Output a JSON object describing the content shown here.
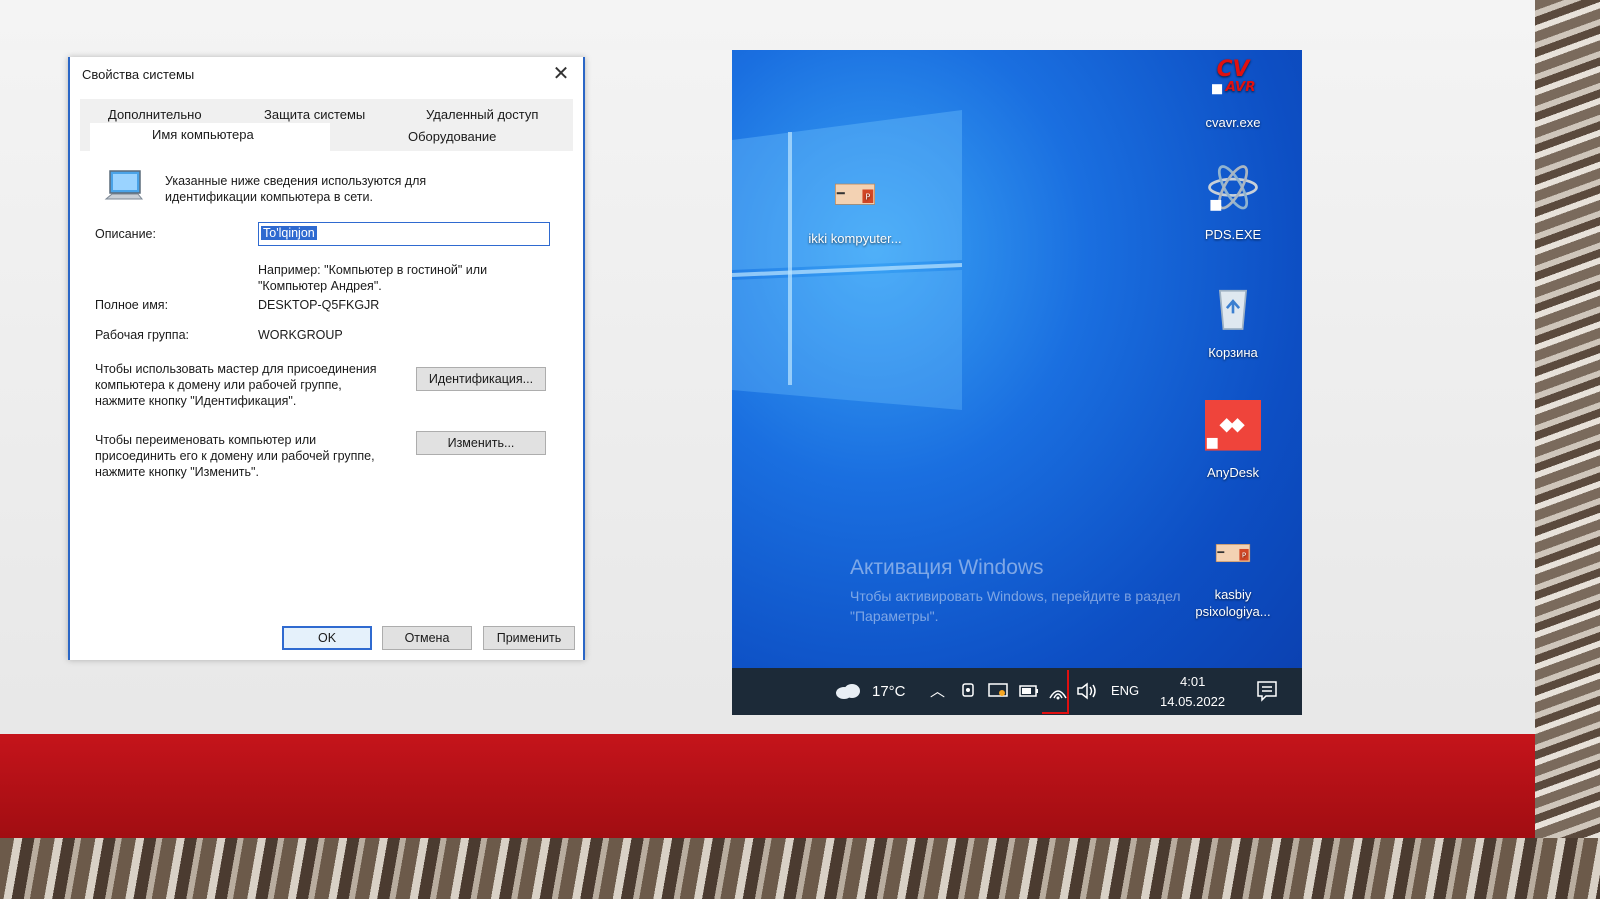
{
  "dialog": {
    "title": "Свойства системы",
    "tabs_row1": [
      "Дополнительно",
      "Защита системы",
      "Удаленный доступ"
    ],
    "tabs_row2": [
      "Имя компьютера",
      "Оборудование"
    ],
    "active_tab": "Имя компьютера",
    "intro": "Указанные ниже сведения используются для идентификации компьютера в сети.",
    "description_label": "Описание:",
    "description_value": "To'lqinjon",
    "example": "Например: \"Компьютер в гостиной\" или \"Компьютер Андрея\".",
    "fullname_label": "Полное имя:",
    "fullname_value": "DESKTOP-Q5FKGJR",
    "workgroup_label": "Рабочая группа:",
    "workgroup_value": "WORKGROUP",
    "id_hint": "Чтобы использовать мастер для присоединения компьютера к домену или рабочей группе, нажмите кнопку \"Идентификация\".",
    "id_button": "Идентификация...",
    "rename_hint": "Чтобы переименовать компьютер или присоединить его к домену или рабочей группе, нажмите кнопку \"Изменить\".",
    "rename_button": "Изменить...",
    "ok_button": "OK",
    "cancel_button": "Отмена",
    "apply_button": "Применить"
  },
  "desktop": {
    "icons": [
      {
        "label": "ikki kompyuter...",
        "icon": "powerpoint-file-icon"
      },
      {
        "label": "cvavr.exe",
        "icon": "cvavr-icon"
      },
      {
        "label": "PDS.EXE",
        "icon": "pds-icon"
      },
      {
        "label": "Корзина",
        "icon": "recycle-bin-icon"
      },
      {
        "label": "AnyDesk",
        "icon": "anydesk-icon"
      },
      {
        "label": "kasbiy psixologiya...",
        "icon": "powerpoint-file-icon"
      }
    ],
    "activation_title": "Активация Windows",
    "activation_text": "Чтобы активировать Windows, перейдите в раздел \"Параметры\".",
    "taskbar": {
      "weather": "17°C",
      "language": "ENG",
      "time": "4:01",
      "date": "14.05.2022"
    }
  },
  "colors": {
    "band_red": "#c5141b",
    "dialog_accent": "#2f6ad0",
    "taskbar": "#1c2a38"
  }
}
